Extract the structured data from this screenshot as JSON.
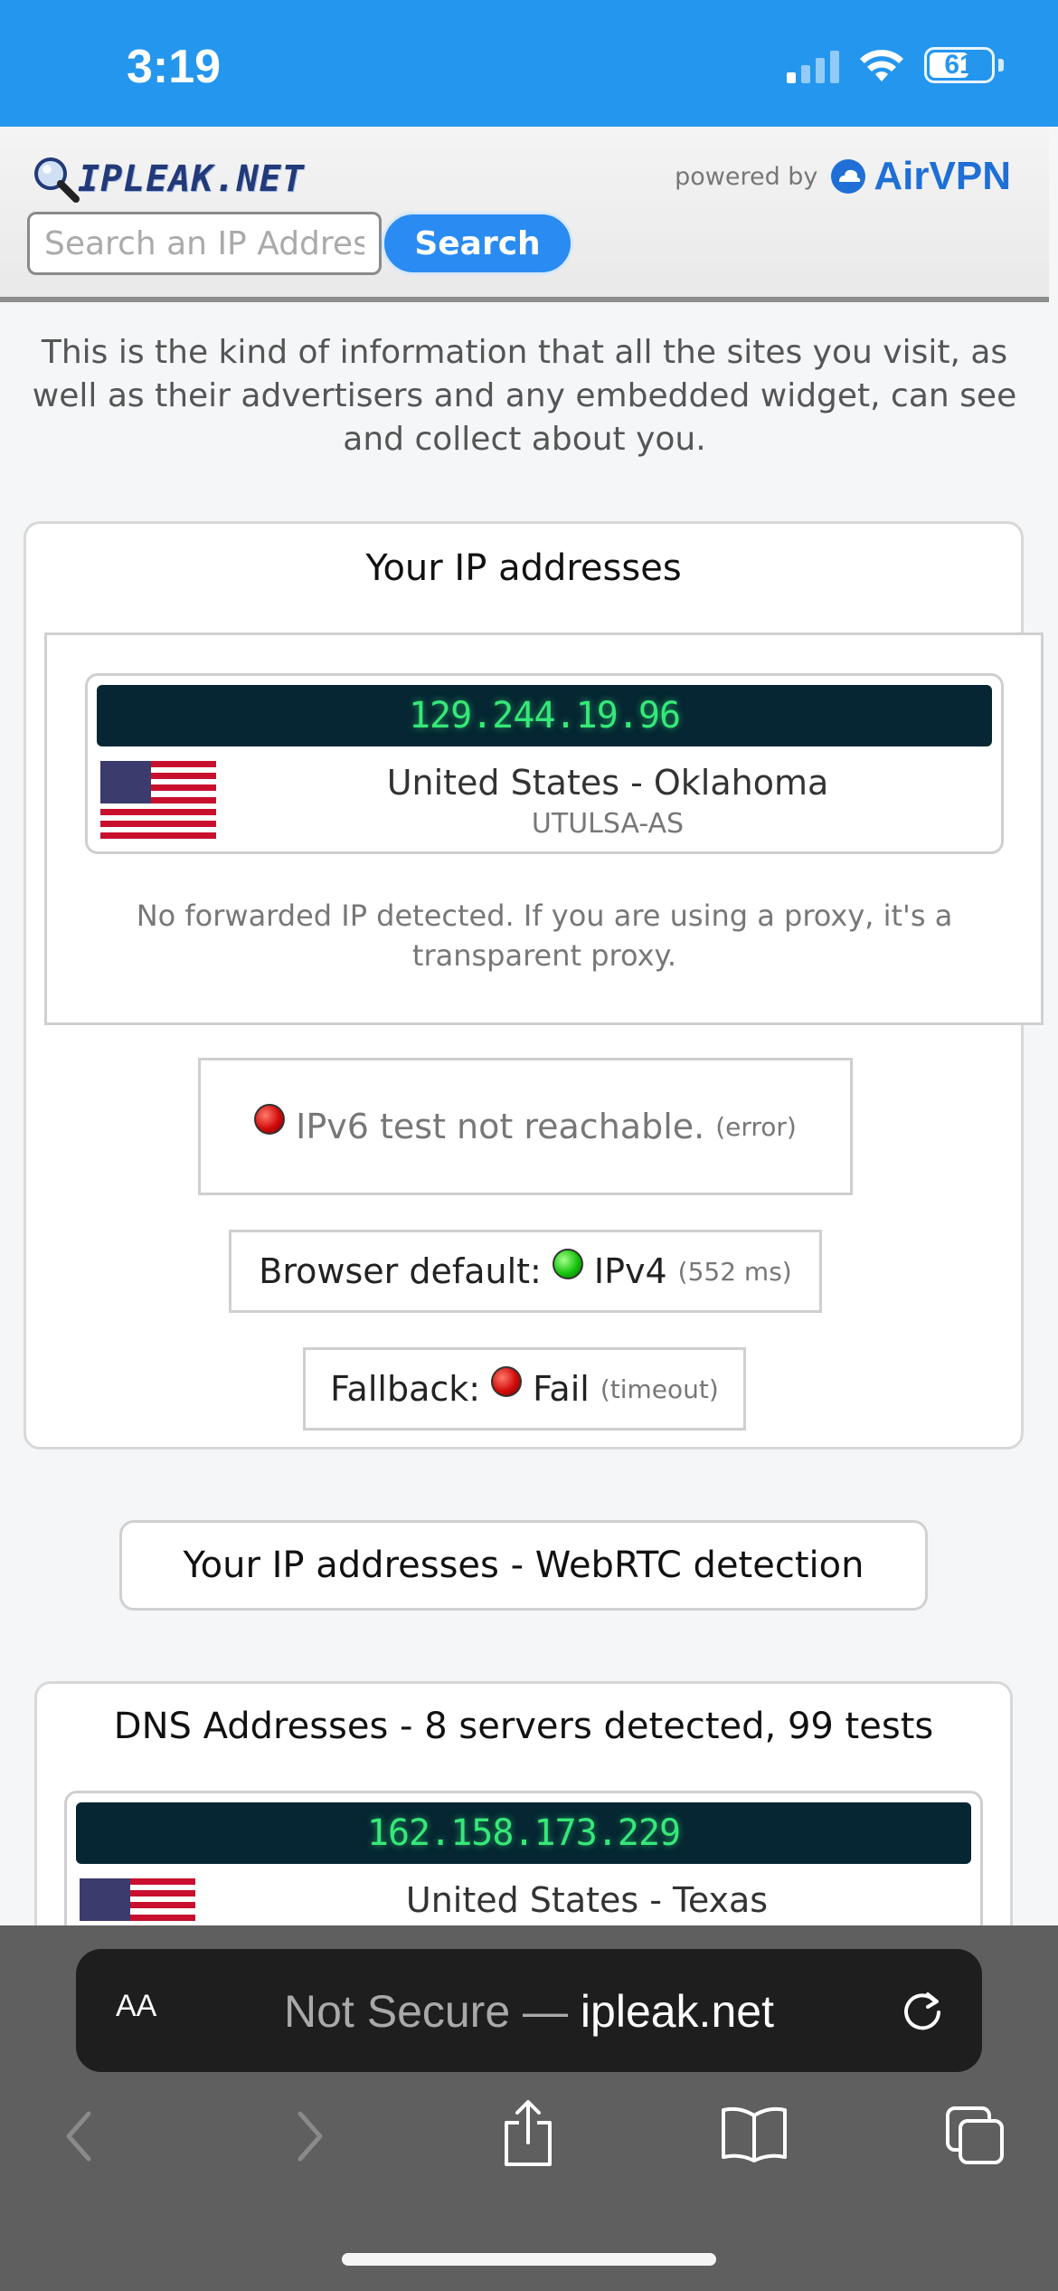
{
  "status_bar": {
    "time": "3:19",
    "battery": "61"
  },
  "header": {
    "logo_text": "IPLEAK.NET",
    "powered_by": "powered by",
    "brand": "AirVPN",
    "search_placeholder": "Search an IP Address",
    "search_button": "Search"
  },
  "intro": "This is the kind of information that all the sites you visit, as well as their advertisers and any embedded widget, can see and collect about you.",
  "ip_section": {
    "title": "Your IP addresses",
    "ip": "129.244.19.96",
    "location": "United States - Oklahoma",
    "isp": "UTULSA-AS",
    "forward_note": "No forwarded IP detected. If you are using a proxy, it's a transparent proxy.",
    "ipv6_text": "IPv6 test not reachable.",
    "ipv6_detail": "(error)",
    "browser_default_label": "Browser default:",
    "browser_default_value": "IPv4",
    "browser_default_detail": "(552 ms)",
    "fallback_label": "Fallback:",
    "fallback_value": "Fail",
    "fallback_detail": "(timeout)"
  },
  "webrtc_button": "Your IP addresses - WebRTC detection",
  "dns_section": {
    "title": "DNS Addresses - 8 servers detected, 99 tests",
    "ip": "162.158.173.229",
    "location": "United States - Texas"
  },
  "safari": {
    "aa": "AA",
    "url_prefix": "Not Secure — ",
    "url_host": "ipleak.net"
  },
  "colors": {
    "accent": "#2596ee",
    "ip_green": "#36e878",
    "ip_bg": "#052632",
    "search_button": "#2a8bf2"
  }
}
